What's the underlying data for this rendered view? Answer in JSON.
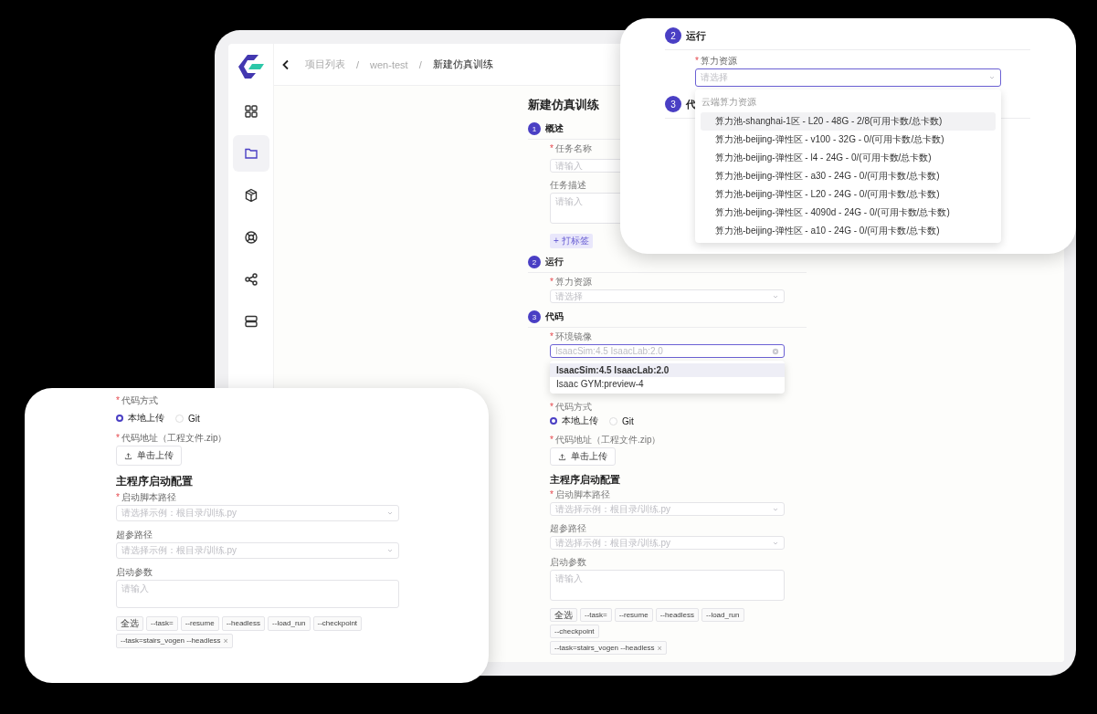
{
  "main_window": {
    "breadcrumb": [
      {
        "kind": "link",
        "text": "项目列表"
      },
      {
        "kind": "separator",
        "text": "/"
      },
      {
        "kind": "link",
        "text": "wen-test"
      },
      {
        "kind": "separator",
        "text": "/"
      },
      {
        "kind": "current",
        "text": "新建仿真训练"
      }
    ],
    "sidebar": [
      {
        "selected": false
      },
      {
        "selected": true
      },
      {
        "selected": false
      },
      {
        "selected": false
      },
      {
        "selected": false
      },
      {
        "selected": false
      }
    ],
    "form": {
      "title": "新建仿真训练",
      "sections": [
        {
          "number": "1",
          "title": "概述",
          "fields": [
            {
              "kind": "input",
              "required_mark": "*",
              "label": "任务名称",
              "placeholder": "请输入"
            },
            {
              "kind": "textarea",
              "label": "任务描述",
              "placeholder": "请输入"
            },
            {
              "kind": "tag_button",
              "label": "+ 打标签"
            }
          ]
        },
        {
          "number": "2",
          "title": "运行",
          "fields": [
            {
              "kind": "select",
              "required_mark": "*",
              "label": "算力资源",
              "placeholder": "请选择",
              "focused": false
            }
          ]
        },
        {
          "number": "3",
          "title": "代码",
          "fields": [
            {
              "kind": "select",
              "required_mark": "*",
              "label": "环境镜像",
              "placeholder": "IsaacSim:4.5 IsaacLab:2.0",
              "focused": true,
              "clearable": true,
              "dropdown": {
                "options": [
                  {
                    "text": "IsaacSim:4.5 IsaacLab:2.0",
                    "selected": true
                  },
                  {
                    "text": "Isaac GYM:preview-4",
                    "selected": false
                  }
                ]
              }
            },
            {
              "kind": "radio",
              "required_mark": "*",
              "label": "代码方式",
              "options": [
                {
                  "text": "本地上传",
                  "selected": true
                },
                {
                  "text": "Git",
                  "selected": false
                }
              ]
            },
            {
              "kind": "upload",
              "required_mark": "*",
              "label": "代码地址（工程文件.zip）",
              "button": "单击上传"
            },
            {
              "kind": "heading",
              "text": "主程序启动配置"
            },
            {
              "kind": "select",
              "required_mark": "*",
              "label": "启动脚本路径",
              "placeholder": "请选择示例：根目录/训练.py",
              "focused": false
            },
            {
              "kind": "select",
              "label": "超参路径",
              "placeholder": "请选择示例：根目录/训练.py",
              "focused": false
            },
            {
              "kind": "textarea",
              "label": "启动参数",
              "placeholder": "请输入"
            },
            {
              "kind": "tags",
              "options": [
                {
                  "text": "全选"
                },
                {
                  "text": "--task="
                },
                {
                  "text": "--resume"
                },
                {
                  "text": "--headless"
                },
                {
                  "text": "--load_run"
                },
                {
                  "text": "--checkpoint"
                }
              ],
              "chosen": [
                {
                  "text": "--task=stairs_vogen --headless",
                  "remove": "×"
                }
              ]
            }
          ]
        }
      ]
    }
  },
  "top_callout": {
    "sections": [
      {
        "number": "2",
        "title": "运行",
        "fields": [
          {
            "kind": "select",
            "required_mark": "*",
            "label": "算力资源",
            "placeholder": "请选择",
            "focused": true,
            "dropdown": {
              "group": "云端算力资源",
              "options": [
                {
                  "text": "算力池-shanghai-1区 - L20 - 48G - 2/8(可用卡数/总卡数)",
                  "selected": true
                },
                {
                  "text": "算力池-beijing-弹性区 - v100 - 32G - 0/(可用卡数/总卡数)",
                  "selected": false
                },
                {
                  "text": "算力池-beijing-弹性区 - l4 - 24G - 0/(可用卡数/总卡数)",
                  "selected": false
                },
                {
                  "text": "算力池-beijing-弹性区 - a30 - 24G - 0/(可用卡数/总卡数)",
                  "selected": false
                },
                {
                  "text": "算力池-beijing-弹性区 - L20 - 24G - 0/(可用卡数/总卡数)",
                  "selected": false
                },
                {
                  "text": "算力池-beijing-弹性区 - 4090d - 24G - 0/(可用卡数/总卡数)",
                  "selected": false
                },
                {
                  "text": "算力池-beijing-弹性区 - a10 - 24G - 0/(可用卡数/总卡数)",
                  "selected": false
                }
              ]
            }
          }
        ]
      },
      {
        "number": "3",
        "title": "代"
      }
    ]
  },
  "bottom_callout": {
    "fields": [
      {
        "kind": "radio",
        "required_mark": "*",
        "label": "代码方式",
        "options": [
          {
            "text": "本地上传",
            "selected": true
          },
          {
            "text": "Git",
            "selected": false
          }
        ]
      },
      {
        "kind": "upload",
        "required_mark": "*",
        "label": "代码地址（工程文件.zip）",
        "button": "单击上传"
      },
      {
        "kind": "heading",
        "text": "主程序启动配置"
      },
      {
        "kind": "select",
        "required_mark": "*",
        "label": "启动脚本路径",
        "placeholder": "请选择示例：根目录/训练.py",
        "focused": false
      },
      {
        "kind": "select",
        "label": "超参路径",
        "placeholder": "请选择示例：根目录/训练.py",
        "focused": false
      },
      {
        "kind": "textarea",
        "label": "启动参数",
        "placeholder": "请输入"
      },
      {
        "kind": "tags",
        "options": [
          {
            "text": "全选"
          },
          {
            "text": "--task="
          },
          {
            "text": "--resume"
          },
          {
            "text": "--headless"
          },
          {
            "text": "--load_run"
          },
          {
            "text": "--checkpoint"
          }
        ],
        "chosen": [
          {
            "text": "--task=stairs_vogen --headless",
            "remove": "×"
          }
        ]
      }
    ]
  }
}
